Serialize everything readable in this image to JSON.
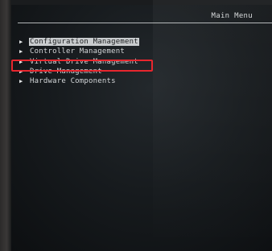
{
  "header": {
    "title": "Main Menu"
  },
  "menu": {
    "items": [
      {
        "label": "Configuration Management",
        "icon": "triangle-right-icon",
        "selected": true
      },
      {
        "label": "Controller Management",
        "icon": "triangle-right-icon",
        "selected": false
      },
      {
        "label": "Virtual Drive Management",
        "icon": "triangle-right-icon",
        "selected": false
      },
      {
        "label": "Drive Management",
        "icon": "triangle-right-icon",
        "selected": false
      },
      {
        "label": "Hardware Components",
        "icon": "triangle-right-icon",
        "selected": false
      }
    ]
  },
  "colors": {
    "background": "#171b1e",
    "text": "#d3d6d8",
    "selection_bg": "#c9ccce",
    "annotation_box": "#e8262e"
  }
}
